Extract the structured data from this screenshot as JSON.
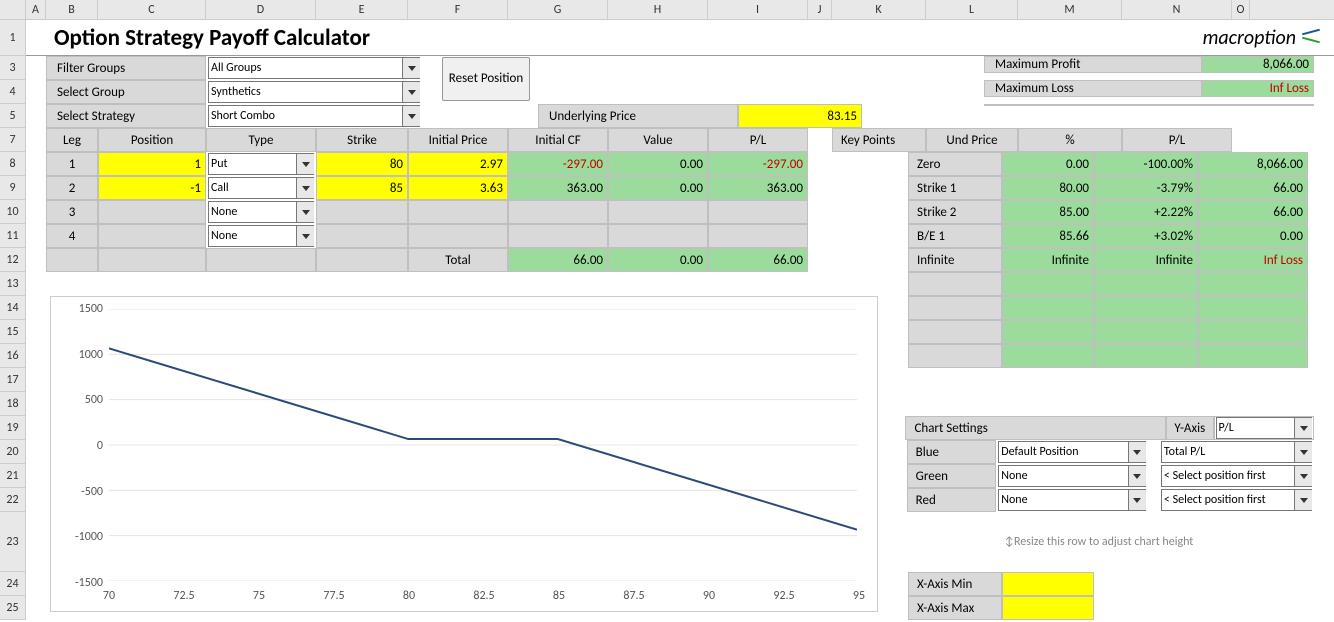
{
  "title": "Option Strategy Payoff Calculator",
  "logo_text": "macroption",
  "controls": {
    "filter_groups_label": "Filter Groups",
    "filter_groups_value": "All Groups",
    "select_group_label": "Select Group",
    "select_group_value": "Synthetics",
    "select_strategy_label": "Select Strategy",
    "select_strategy_value": "Short Combo",
    "reset_button": "Reset Position",
    "underlying_label": "Underlying Price",
    "underlying_value": "83.15"
  },
  "summary": {
    "max_profit_label": "Maximum Profit",
    "max_profit_value": "8,066.00",
    "max_loss_label": "Maximum Loss",
    "max_loss_value": "Inf Loss"
  },
  "legs_headers": {
    "leg": "Leg",
    "position": "Position",
    "type": "Type",
    "strike": "Strike",
    "init_price": "Initial Price",
    "init_cf": "Initial CF",
    "value": "Value",
    "pl": "P/L"
  },
  "legs": [
    {
      "leg": "1",
      "position": "1",
      "type": "Put",
      "strike": "80",
      "init_price": "2.97",
      "init_cf": "-297.00",
      "value": "0.00",
      "pl": "-297.00"
    },
    {
      "leg": "2",
      "position": "-1",
      "type": "Call",
      "strike": "85",
      "init_price": "3.63",
      "init_cf": "363.00",
      "value": "0.00",
      "pl": "363.00"
    },
    {
      "leg": "3",
      "position": "",
      "type": "None",
      "strike": "",
      "init_price": "",
      "init_cf": "",
      "value": "",
      "pl": ""
    },
    {
      "leg": "4",
      "position": "",
      "type": "None",
      "strike": "",
      "init_price": "",
      "init_cf": "",
      "value": "",
      "pl": ""
    }
  ],
  "totals": {
    "label": "Total",
    "init_cf": "66.00",
    "value": "0.00",
    "pl": "66.00"
  },
  "keypoints_headers": {
    "kp": "Key Points",
    "und": "Und Price",
    "pct": "%",
    "pl": "P/L"
  },
  "keypoints": [
    {
      "kp": "Zero",
      "und": "0.00",
      "pct": "-100.00%",
      "pl": "8,066.00"
    },
    {
      "kp": "Strike 1",
      "und": "80.00",
      "pct": "-3.79%",
      "pl": "66.00"
    },
    {
      "kp": "Strike 2",
      "und": "85.00",
      "pct": "+2.22%",
      "pl": "66.00"
    },
    {
      "kp": "B/E 1",
      "und": "85.66",
      "pct": "+3.02%",
      "pl": "0.00"
    },
    {
      "kp": "Infinite",
      "und": "Infinite",
      "pct": "Infinite",
      "pl": "Inf Loss"
    }
  ],
  "chart_settings": {
    "header": "Chart Settings",
    "yaxis_label": "Y-Axis",
    "yaxis_value": "P/L",
    "blue_label": "Blue",
    "blue_value": "Default Position",
    "blue_series": "Total P/L",
    "green_label": "Green",
    "green_value": "None",
    "green_series": "< Select position first",
    "red_label": "Red",
    "red_value": "None",
    "red_series": "< Select position first",
    "resize_hint": "Resize this row to adjust chart height",
    "xmin_label": "X-Axis Min",
    "xmin_value": "",
    "xmax_label": "X-Axis Max",
    "xmax_value": ""
  },
  "chart_data": {
    "type": "line",
    "xlabel": "",
    "ylabel": "",
    "xlim": [
      70,
      95
    ],
    "ylim": [
      -1500,
      1500
    ],
    "x_ticks": [
      70,
      72.5,
      75,
      77.5,
      80,
      82.5,
      85,
      87.5,
      90,
      92.5,
      95
    ],
    "y_ticks": [
      -1500,
      -1000,
      -500,
      0,
      500,
      1000,
      1500
    ],
    "series": [
      {
        "name": "Total P/L",
        "color": "#2b4a7a",
        "x": [
          70,
          80,
          85,
          95
        ],
        "y": [
          1066,
          66,
          66,
          -934
        ]
      }
    ]
  },
  "col_letters": [
    "A",
    "B",
    "C",
    "D",
    "E",
    "F",
    "G",
    "H",
    "I",
    "J",
    "K",
    "L",
    "M",
    "N",
    "O"
  ],
  "row_numbers": [
    "1",
    "3",
    "4",
    "5",
    "7",
    "8",
    "9",
    "10",
    "11",
    "12",
    "13",
    "14",
    "15",
    "16",
    "17",
    "18",
    "19",
    "20",
    "21",
    "22",
    "23",
    "24",
    "25"
  ]
}
